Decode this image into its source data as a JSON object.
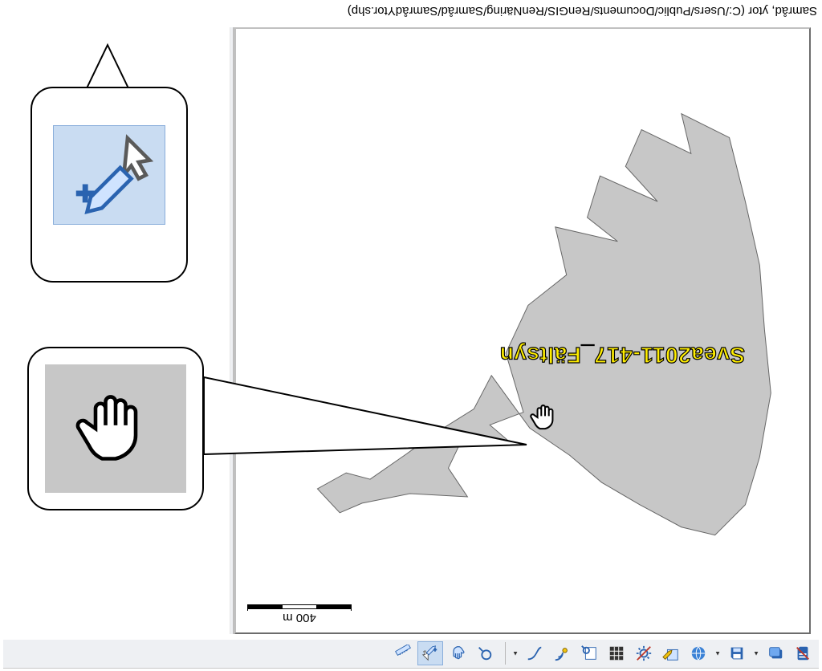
{
  "titlebar": {
    "text": "Samråd, ytor (C:/Users/Public/Documents/RenGIS/RenNäring/Samråd/SamrådYtor.shp)"
  },
  "map": {
    "scalebar_label": "400 m",
    "feature_label": "Svea2011-417_Fältsyn"
  },
  "toolbar": {
    "items": [
      {
        "name": "measure-icon",
        "kind": "measure"
      },
      {
        "name": "select-edit-vertex-icon",
        "kind": "selectedit",
        "selected": true
      },
      {
        "name": "pan-hand-icon",
        "kind": "hand"
      },
      {
        "name": "zoom-icon",
        "kind": "zoom"
      }
    ],
    "left_items": [
      {
        "name": "table-icon",
        "kind": "table"
      },
      {
        "name": "curve-icon",
        "kind": "curve"
      },
      {
        "name": "gps-satellite-icon",
        "kind": "gps"
      },
      {
        "name": "find-layer-icon",
        "kind": "findlayer"
      },
      {
        "name": "grid-icon",
        "kind": "grid"
      },
      {
        "name": "layers-gear-icon",
        "kind": "gear"
      },
      {
        "name": "edit-layer-icon",
        "kind": "editlayer"
      },
      {
        "name": "globe-icon",
        "kind": "globe"
      },
      {
        "name": "save-icon",
        "kind": "save"
      },
      {
        "name": "stack-icon",
        "kind": "stack"
      },
      {
        "name": "scroll-annotate-icon",
        "kind": "scroll"
      }
    ]
  }
}
